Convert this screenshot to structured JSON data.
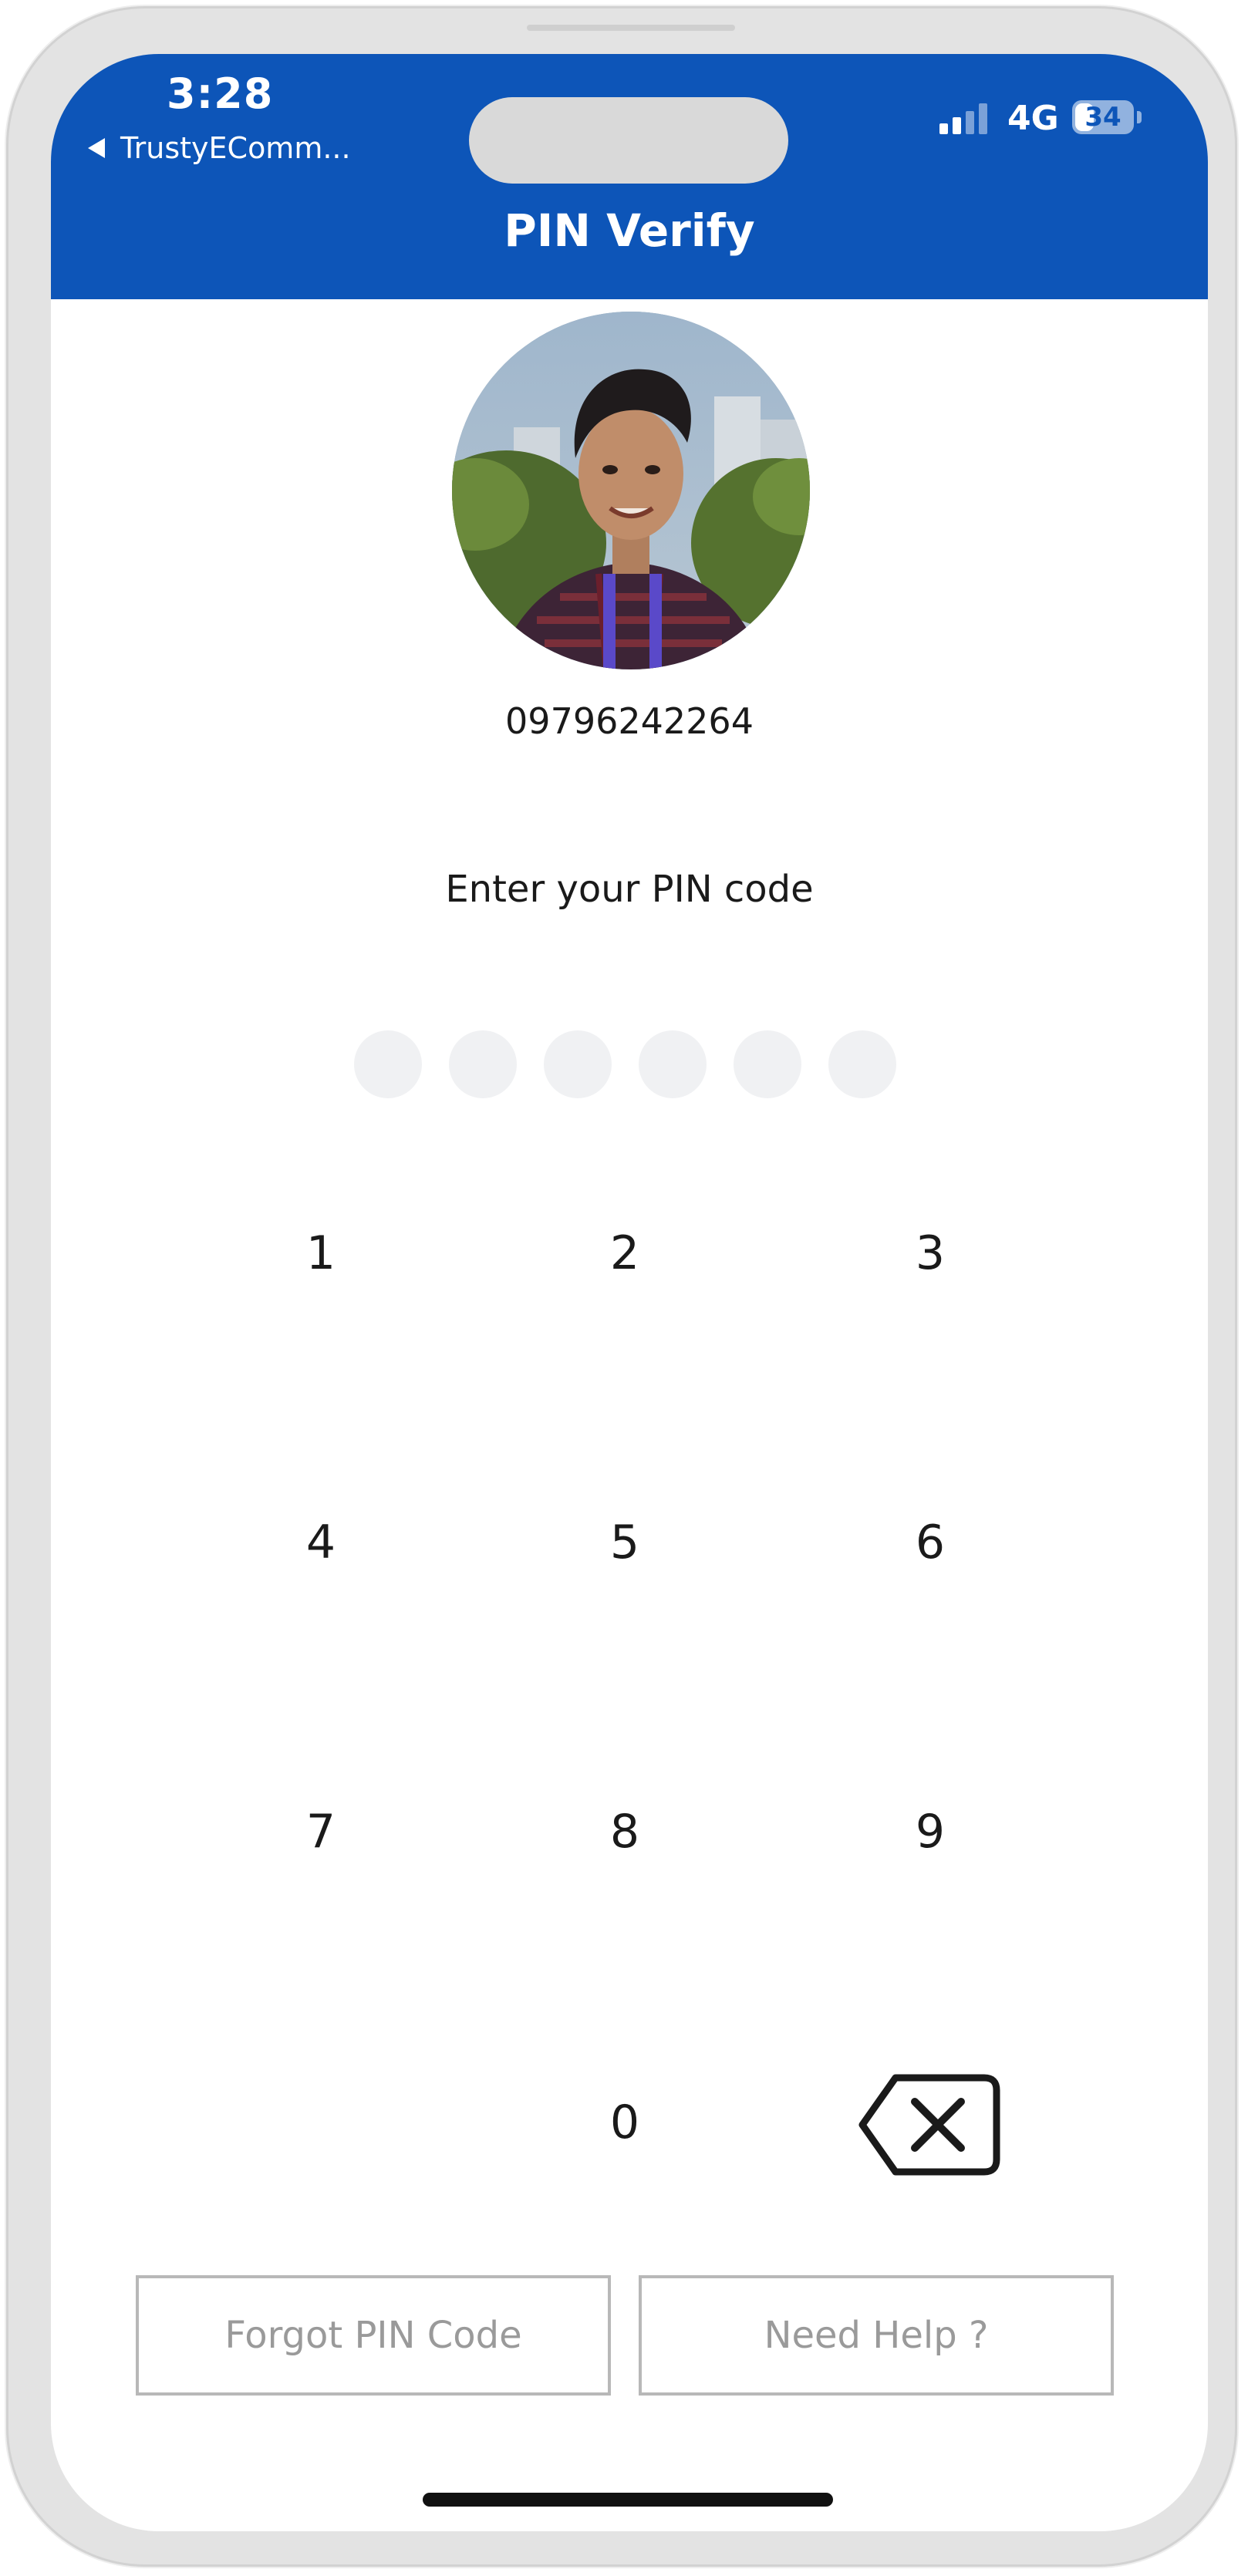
{
  "status_bar": {
    "time": "3:28",
    "back_app": "TrustyEComm...",
    "network": "4G",
    "battery": "34",
    "battery_level": 0.34
  },
  "header": {
    "title": "PIN Verify"
  },
  "profile": {
    "phone": "09796242264"
  },
  "pin": {
    "prompt": "Enter your PIN code",
    "length": 6
  },
  "keypad": {
    "keys": [
      "1",
      "2",
      "3",
      "4",
      "5",
      "6",
      "7",
      "8",
      "9",
      "0"
    ]
  },
  "actions": {
    "forgot_label": "Forgot PIN Code",
    "help_label": "Need Help ?"
  },
  "colors": {
    "header": "#0d55b8",
    "dot": "#f0f1f3",
    "button_border": "#b8b8b8",
    "button_text": "#9a9a9a"
  },
  "icons": {
    "back": "back-triangle-icon",
    "signal": "cellular-signal-icon",
    "battery": "battery-icon",
    "delete": "backspace-icon"
  }
}
